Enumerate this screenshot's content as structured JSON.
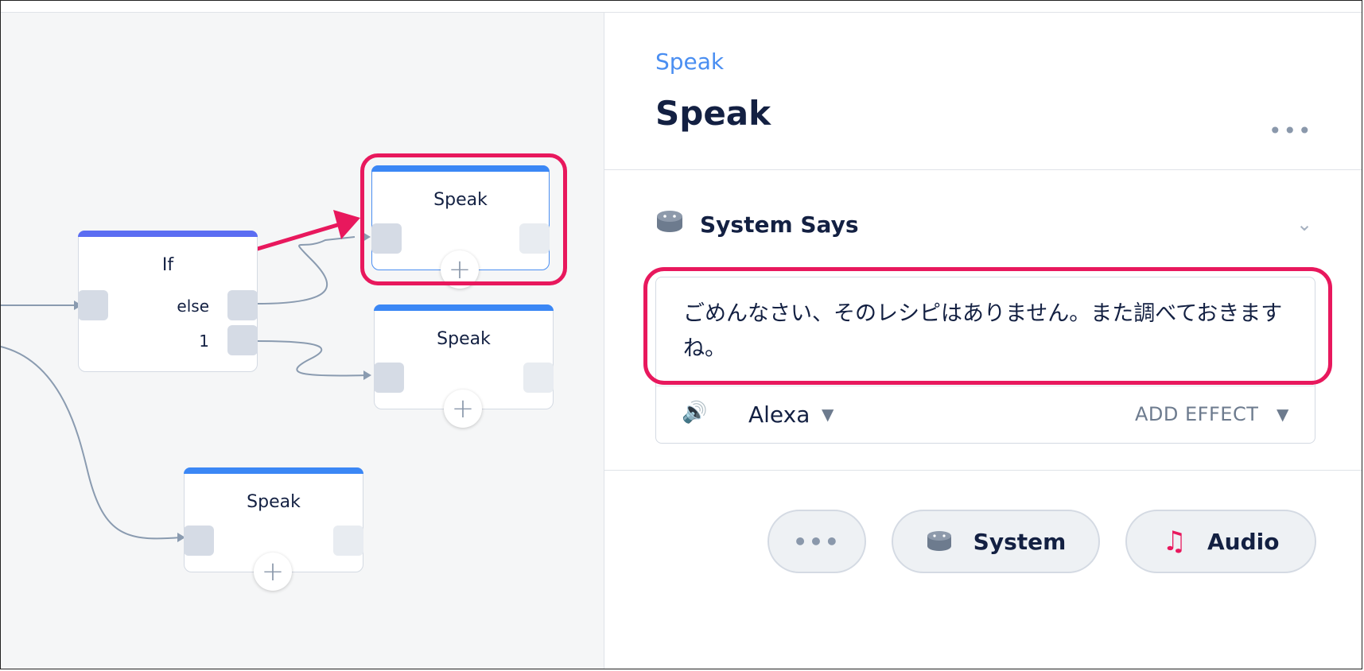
{
  "canvas": {
    "if_block": {
      "title": "If",
      "branches": [
        "else",
        "1"
      ]
    },
    "speak_blocks": [
      "Speak",
      "Speak",
      "Speak"
    ],
    "colors": {
      "speak_cap": "#3b87f5",
      "if_cap": "#5b6df2",
      "highlight": "#e8185d",
      "wire": "#8a9bb0"
    }
  },
  "panel": {
    "breadcrumb": "Speak",
    "title": "Speak",
    "more_label": "•••",
    "section": {
      "title": "System Says",
      "icon": "alexa-device-icon",
      "speech_text": "ごめんなさい、そのレシピはありません。また調べておきますね。",
      "voice": "Alexa",
      "add_effect": "ADD EFFECT"
    },
    "buttons": {
      "more": "•••",
      "system": "System",
      "audio": "Audio"
    }
  }
}
